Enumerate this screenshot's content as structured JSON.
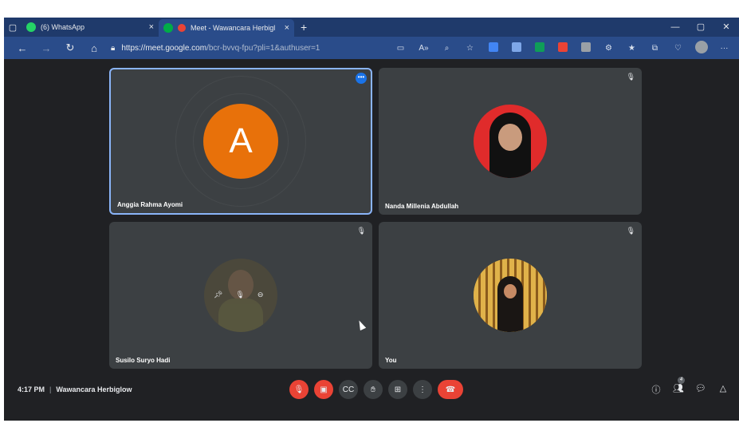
{
  "tabs": [
    {
      "label": "(6) WhatsApp",
      "close": "×"
    },
    {
      "label": "Meet - Wawancara Herbigl",
      "close": "×"
    }
  ],
  "new_tab": "+",
  "window_controls": {
    "minimize": "—",
    "maximize": "▢",
    "close": "✕"
  },
  "address": {
    "host": "https://meet.google.com",
    "rest": "/bcr-bvvq-fpu?pli=1&authuser=1"
  },
  "participants": [
    {
      "name": "Anggia Rahma Ayomi",
      "initial": "A",
      "speaking": true
    },
    {
      "name": "Nanda Millenia Abdullah"
    },
    {
      "name": "Susilo Suryo Hadi"
    },
    {
      "name": "You"
    }
  ],
  "meeting": {
    "time": "4:17 PM",
    "title": "Wawancara Herbiglow",
    "separator": "|"
  },
  "people_count": "4",
  "colors": {
    "accent": "#8ab4f8",
    "danger": "#ea4335",
    "avatar": "#e8710a"
  }
}
